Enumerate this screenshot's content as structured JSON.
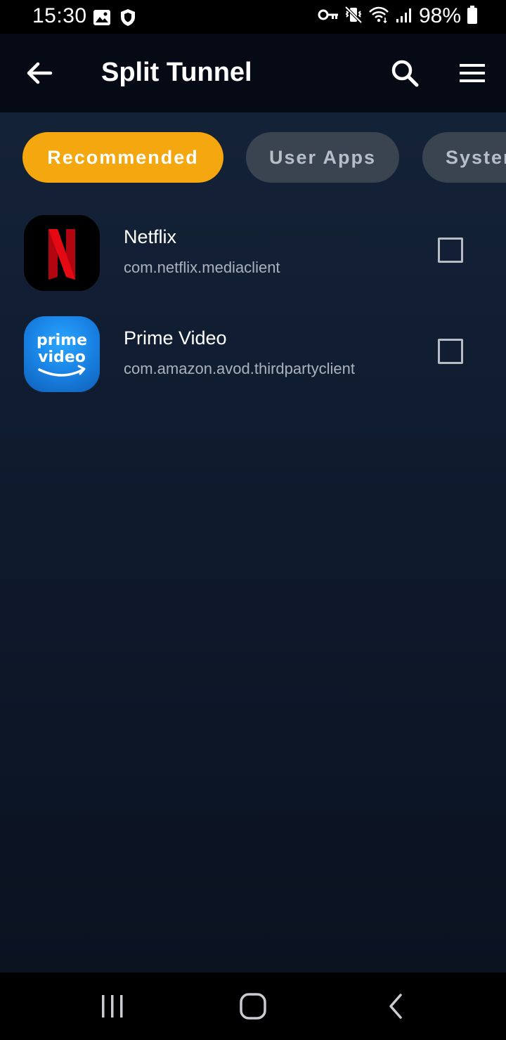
{
  "status_bar": {
    "time": "15:30",
    "battery_percent": "98%",
    "left_icons": [
      "image-icon",
      "shield-icon"
    ],
    "right_icons": [
      "key-icon",
      "vibrate-icon",
      "wifi-icon",
      "signal-icon",
      "battery-icon"
    ]
  },
  "app_bar": {
    "title": "Split Tunnel",
    "back_icon": "arrow-left-icon",
    "search_icon": "search-icon",
    "menu_icon": "hamburger-menu-icon"
  },
  "tabs": [
    {
      "label": "Recommended",
      "selected": true
    },
    {
      "label": "User Apps",
      "selected": false
    },
    {
      "label": "System Apps",
      "selected": false
    }
  ],
  "apps": [
    {
      "name": "Netflix",
      "package": "com.netflix.mediaclient",
      "checked": false,
      "icon": "netflix-icon"
    },
    {
      "name": "Prime Video",
      "package": "com.amazon.avod.thirdpartyclient",
      "checked": false,
      "icon": "prime-video-icon",
      "icon_text_line1": "prime",
      "icon_text_line2": "video"
    }
  ],
  "nav_bar": {
    "icons": [
      "recent-apps-icon",
      "home-icon",
      "back-icon"
    ]
  },
  "colors": {
    "accent": "#f4a70f",
    "chip_inactive": "#3a4350",
    "netflix_red": "#e50914",
    "prime_blue": "#1a98ff"
  }
}
